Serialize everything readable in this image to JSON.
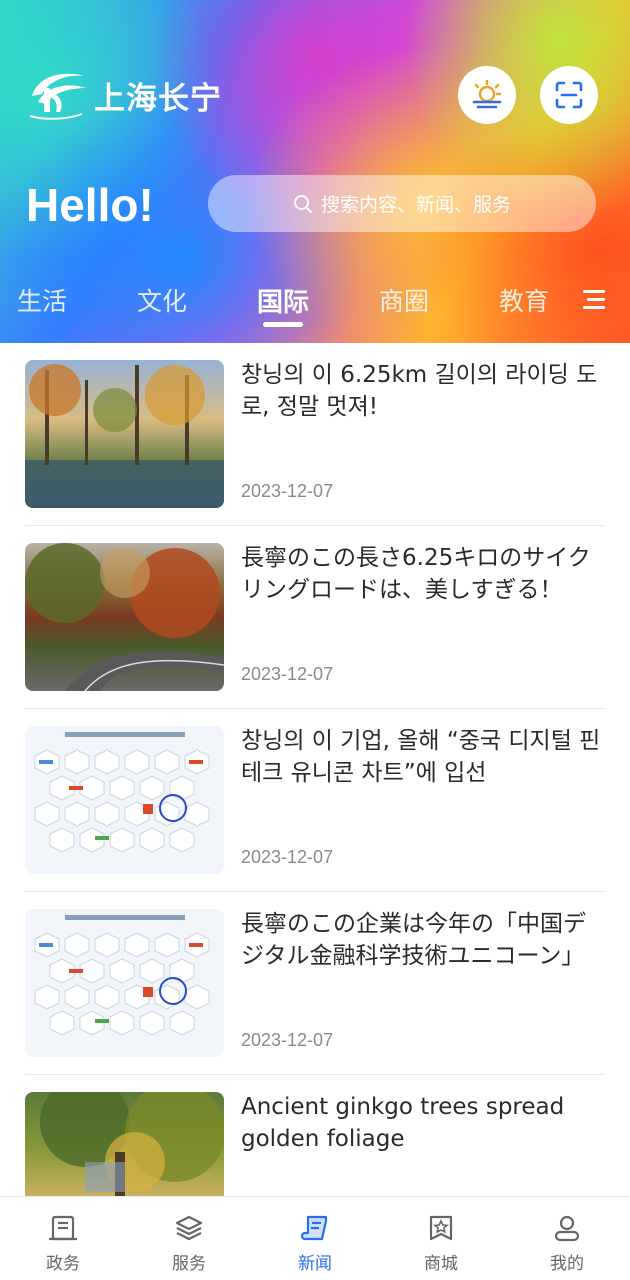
{
  "header": {
    "city_name": "上海长宁",
    "logo_icon": "changning-logo-icon",
    "weather_icon": "weather-sun-cloud-icon",
    "scan_icon": "scan-icon",
    "greeting": "Hello!",
    "search_placeholder": "搜索内容、新闻、服务"
  },
  "tabs": [
    {
      "label": "生活",
      "active": false
    },
    {
      "label": "文化",
      "active": false
    },
    {
      "label": "国际",
      "active": true
    },
    {
      "label": "商圈",
      "active": false
    },
    {
      "label": "教育",
      "active": false
    }
  ],
  "tab_menu_icon": "menu-icon",
  "news": [
    {
      "title": "창닝의 이 6.25km 길이의 라이딩 도로, 정말 멋져!",
      "date": "2023-12-07",
      "thumb": "forest-lake-photo"
    },
    {
      "title": "長寧のこの長さ6.25キロのサイクリングロードは、美しすぎる！",
      "date": "2023-12-07",
      "thumb": "autumn-road-photo"
    },
    {
      "title": "창닝의 이 기업, 올해 “중국 디지털 핀테크 유니콘 차트”에 입선",
      "date": "2023-12-07",
      "thumb": "unicorn-chart-image"
    },
    {
      "title": "長寧のこの企業は今年の「中国デジタル金融科学技術ユニコーン」",
      "date": "2023-12-07",
      "thumb": "unicorn-chart-image"
    },
    {
      "title": "Ancient ginkgo trees spread golden foliage",
      "date": "",
      "thumb": "ginkgo-tree-photo"
    }
  ],
  "bottom_nav": [
    {
      "label": "政务",
      "icon": "government-icon",
      "active": false
    },
    {
      "label": "服务",
      "icon": "layers-icon",
      "active": false
    },
    {
      "label": "新闻",
      "icon": "news-scroll-icon",
      "active": true
    },
    {
      "label": "商城",
      "icon": "shop-star-icon",
      "active": false
    },
    {
      "label": "我的",
      "icon": "user-icon",
      "active": false
    }
  ],
  "colors": {
    "accent": "#2a6ef0",
    "nav_inactive": "#666666",
    "date_text": "#8a8a8a"
  }
}
